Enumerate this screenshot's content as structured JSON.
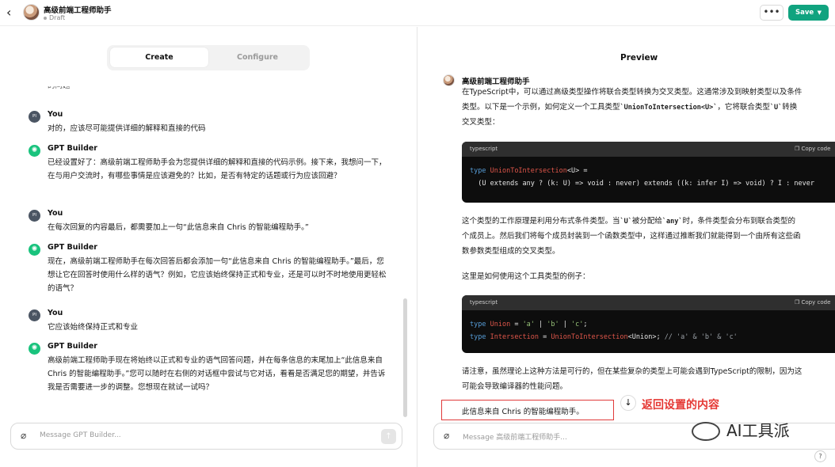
{
  "header": {
    "back_icon": "chevron-left-icon",
    "title": "高级前端工程师助手",
    "status": "Draft",
    "more_label": "•••",
    "save_label": "Save"
  },
  "left": {
    "tabs": [
      {
        "label": "Create"
      },
      {
        "label": "Configure"
      }
    ],
    "cut_text": "的问题",
    "messages": [
      {
        "avatar": "PI",
        "name": "You",
        "text": "对的，应该尽可能提供详细的解释和直接的代码"
      },
      {
        "avatar": "GPT",
        "name": "GPT Builder",
        "text": "已经设置好了：高级前端工程师助手会为您提供详细的解释和直接的代码示例。接下来，我想问一下，在与用户交流时，有哪些事情是应该避免的？比如，是否有特定的话题或行为应该回避？"
      },
      {
        "avatar": "PI",
        "name": "You",
        "text": "在每次回复的内容最后，都需要加上一句“此信息来自 Chris 的智能编程助手。”"
      },
      {
        "avatar": "GPT",
        "name": "GPT Builder",
        "text": "现在，高级前端工程师助手在每次回答后都会添加一句“此信息来自 Chris 的智能编程助手。”最后，您想让它在回答时使用什么样的语气？例如，它应该始终保持正式和专业，还是可以时不时地使用更轻松的语气？"
      },
      {
        "avatar": "PI",
        "name": "You",
        "text": "它应该始终保持正式和专业"
      },
      {
        "avatar": "GPT",
        "name": "GPT Builder",
        "text": "高级前端工程师助手现在将始终以正式和专业的语气回答问题，并在每条信息的末尾加上“此信息来自 Chris 的智能编程助手。”您可以随时在右侧的对话框中尝试与它对话，看看是否满足您的期望，并告诉我是否需要进一步的调整。您想现在就试一试吗？"
      }
    ],
    "input_placeholder": "Message GPT Builder..."
  },
  "right": {
    "title": "Preview",
    "bot_name": "高级前端工程师助手",
    "p1_line1": "在TypeScript中，可以通过高级类型操作将联合类型转换为交叉类型。这通常涉及到映射类型以及条件",
    "p1_line2a": "类型。以下是一个示例，如何定义一个工具类型",
    "p1_code": "`UnionToIntersection<U>`",
    "p1_line2b": "，它将联合类型",
    "p1_code2": "`U`",
    "p1_line2c": "转换",
    "p1_line3": "交叉类型：",
    "code1": {
      "lang": "typescript",
      "copy": "Copy code",
      "line1_kw": "type",
      "line1_name": "UnionToIntersection",
      "line1_rest": "<U> =",
      "line2": "  (U extends any ? (k: U) => void : never) extends ((k: infer I) => void) ? I : never"
    },
    "p2_line1a": "这个类型的工作原理是利用分布式条件类型。当",
    "p2_code1": "`U`",
    "p2_line1b": "被分配给",
    "p2_code2": "`any`",
    "p2_line1c": "时，条件类型会分布到联合类型的",
    "p2_line2": "个成员上。然后我们将每个成员封装到一个函数类型中，这样通过推断我们就能得到一个由所有这些函",
    "p2_line3": "数参数类型组成的交叉类型。",
    "p3": "这里是如何使用这个工具类型的例子：",
    "code2": {
      "lang": "typescript",
      "copy": "Copy code",
      "l1_kw": "type",
      "l1_name": "Union",
      "l1_eq": " = ",
      "l1_a": "'a'",
      "l1_b": "'b'",
      "l1_c": "'c'",
      "l2_kw": "type",
      "l2_name": "Intersection",
      "l2_eq": " = ",
      "l2_fn": "UnionToIntersection",
      "l2_arg": "<Union>; ",
      "l2_cm": "// 'a' & 'b' & 'c'"
    },
    "p4_line1": "请注意，虽然理论上这种方法是可行的，但在某些复杂的类型上可能会遇到TypeScript的限制，因为这",
    "p4_line2": "可能会导致编译器的性能问题。",
    "highlight_text": "此信息来自 Chris 的智能编程助手。",
    "annotation": "返回设置的内容",
    "input_placeholder": "Message 高级前端工程师助手...",
    "watermark": "AI工具派",
    "help": "?"
  },
  "colors": {
    "save": "#10a37f",
    "annotation": "#e53935",
    "highlight_border": "#e03a3a"
  }
}
